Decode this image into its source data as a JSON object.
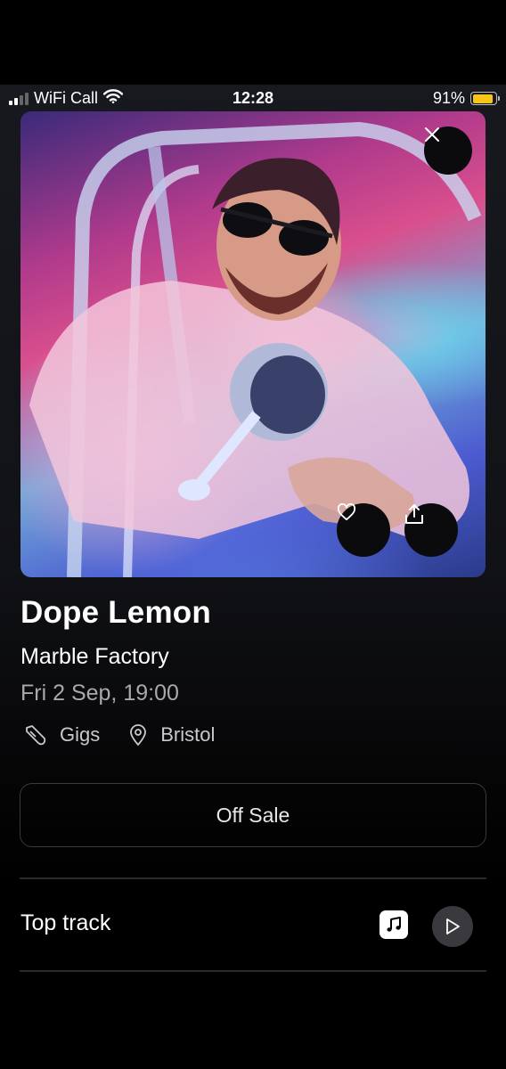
{
  "status_bar": {
    "carrier": "WiFi Call",
    "time": "12:28",
    "battery_percent": "91%",
    "battery_level": 0.91,
    "battery_color": "#f5c518"
  },
  "hero": {
    "close_icon": "close-icon",
    "favorite_icon": "heart-icon",
    "share_icon": "share-icon"
  },
  "event": {
    "title": "Dope Lemon",
    "venue": "Marble Factory",
    "datetime": "Fri 2 Sep, 19:00",
    "category": "Gigs",
    "city": "Bristol"
  },
  "ticket_button": {
    "label": "Off Sale"
  },
  "top_track": {
    "label": "Top track",
    "service_icon": "music-note-icon",
    "play_icon": "play-icon"
  }
}
